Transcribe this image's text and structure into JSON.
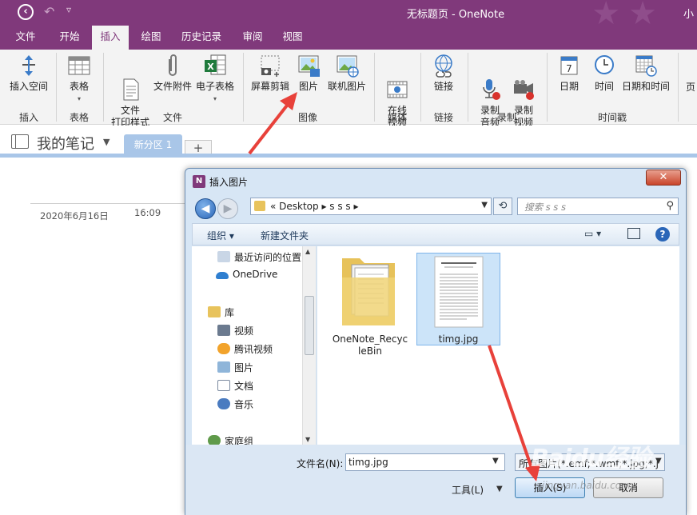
{
  "window": {
    "title": "无标题页 - OneNote",
    "user_partial": "小"
  },
  "menu_tabs": [
    "文件",
    "开始",
    "插入",
    "绘图",
    "历史记录",
    "审阅",
    "视图"
  ],
  "ribbon": {
    "buttons": {
      "insert_space": "插入空间",
      "table": "表格",
      "file_printout": "文件\n打印样式",
      "file_attachment": "文件附件",
      "spreadsheet": "电子表格",
      "screen_clipping": "屏幕剪辑",
      "picture": "图片",
      "online_picture": "联机图片",
      "online_video": "在线\n视频",
      "link": "链接",
      "record_audio": "录制\n音频",
      "record_video": "录制\n视频",
      "date": "日期",
      "time": "时间",
      "date_time": "日期和时间",
      "page_partial": "页"
    },
    "groups": {
      "insert": "插入",
      "tables": "表格",
      "files": "文件",
      "images": "图像",
      "media": "媒体",
      "links": "链接",
      "recording": "录制",
      "timestamp": "时间戳"
    }
  },
  "notebook": {
    "name": "我的笔记",
    "section_tab": "新分区 1",
    "add_tab": "+"
  },
  "page": {
    "date": "2020年6月16日",
    "time": "16:09"
  },
  "dialog": {
    "title": "插入图片",
    "close": "✕",
    "address": "« Desktop ▸ s s s ▸",
    "search_placeholder": "搜索 s s s",
    "organize": "组织 ▾",
    "new_folder": "新建文件夹",
    "nav_items": [
      "最近访问的位置",
      "OneDrive",
      "库",
      "视频",
      "腾讯视频",
      "图片",
      "文档",
      "音乐",
      "家庭组"
    ],
    "files": [
      {
        "name": "OneNote_RecycleBin",
        "line1": "OneNote_Recyc",
        "line2": "leBin",
        "type": "folder"
      },
      {
        "name": "timg.jpg",
        "type": "image",
        "selected": true
      }
    ],
    "filename_label": "文件名(N):",
    "filename_value": "timg.jpg",
    "filetype_value": "所有图片(*.emf;*.wmf;*.jpg;*.j",
    "tools_label": "工具(L)",
    "insert_button": "插入(S)",
    "cancel_button": "取消"
  },
  "watermark": {
    "brand": "Baidu经验",
    "url": "jingyan.baidu.com"
  },
  "colors": {
    "onenote_purple": "#80397B",
    "section_blue": "#a9c6e8",
    "arrow_red": "#e8413a",
    "selection_blue": "#cce4f9"
  }
}
